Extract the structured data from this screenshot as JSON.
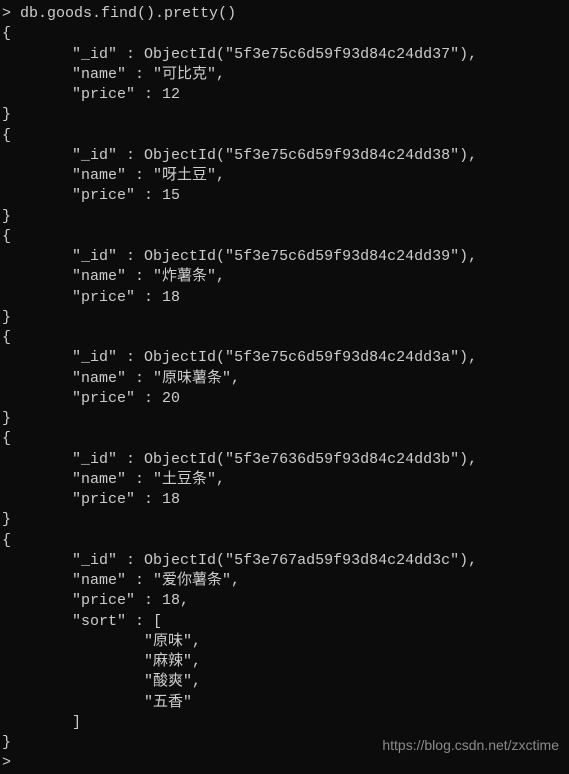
{
  "command": "db.goods.find().pretty()",
  "prompt": ">",
  "docs": [
    {
      "id": "5f3e75c6d59f93d84c24dd37",
      "name": "可比克",
      "price": 12
    },
    {
      "id": "5f3e75c6d59f93d84c24dd38",
      "name": "呀土豆",
      "price": 15
    },
    {
      "id": "5f3e75c6d59f93d84c24dd39",
      "name": "炸薯条",
      "price": 18
    },
    {
      "id": "5f3e75c6d59f93d84c24dd3a",
      "name": "原味薯条",
      "price": 20
    },
    {
      "id": "5f3e7636d59f93d84c24dd3b",
      "name": "土豆条",
      "price": 18
    },
    {
      "id": "5f3e767ad59f93d84c24dd3c",
      "name": "爱你薯条",
      "price": 18,
      "sort": [
        "原味",
        "麻辣",
        "酸爽",
        "五香"
      ]
    }
  ],
  "labels": {
    "id_key": "\"_id\"",
    "name_key": "\"name\"",
    "price_key": "\"price\"",
    "sort_key": "\"sort\"",
    "objectid": "ObjectId",
    "open_brace": "{",
    "close_brace": "}",
    "open_bracket": "[",
    "close_bracket": "]"
  },
  "watermark": "https://blog.csdn.net/zxctime"
}
